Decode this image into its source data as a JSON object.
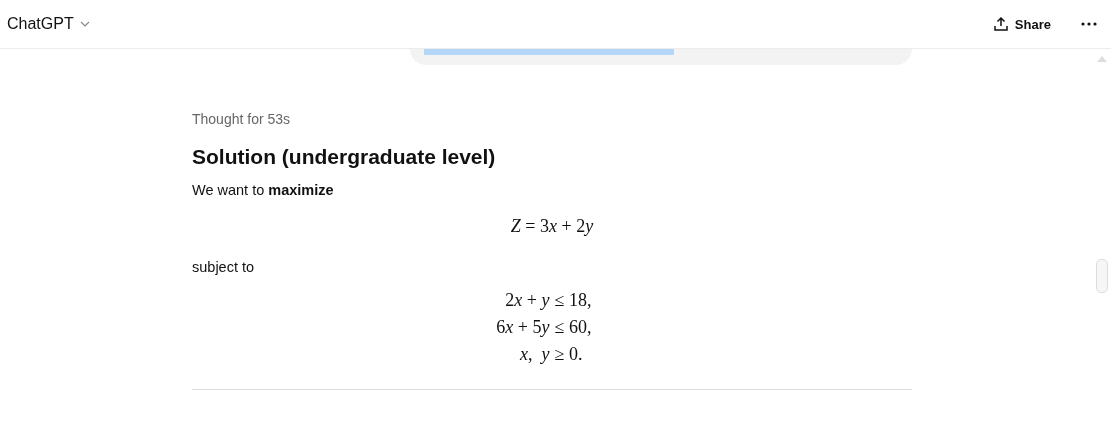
{
  "header": {
    "title": "ChatGPT",
    "share_label": "Share"
  },
  "response": {
    "thought": "Thought for 53s",
    "heading": "Solution (undergraduate level)",
    "intro": "We want to **maximize**",
    "objective": [
      {
        "t": "Z",
        "var": true
      },
      {
        "t": " = 3",
        "var": false
      },
      {
        "t": "x",
        "var": true
      },
      {
        "t": " + 2",
        "var": false
      },
      {
        "t": "y",
        "var": true
      }
    ],
    "subject": "subject to",
    "constraints": [
      {
        "lhs": [
          {
            "t": "2",
            "var": false
          },
          {
            "t": "x",
            "var": true
          },
          {
            "t": " + ",
            "var": false
          },
          {
            "t": "y",
            "var": true
          }
        ],
        "rhs": "≤ 18,"
      },
      {
        "lhs": [
          {
            "t": "6",
            "var": false
          },
          {
            "t": "x",
            "var": true
          },
          {
            "t": " + 5",
            "var": false
          },
          {
            "t": "y",
            "var": true
          }
        ],
        "rhs": "≤ 60,"
      },
      {
        "lhs": [
          {
            "t": "x",
            "var": true
          },
          {
            "t": ",  ",
            "var": false
          },
          {
            "t": "y",
            "var": true
          }
        ],
        "rhs": "≥ 0."
      }
    ]
  }
}
